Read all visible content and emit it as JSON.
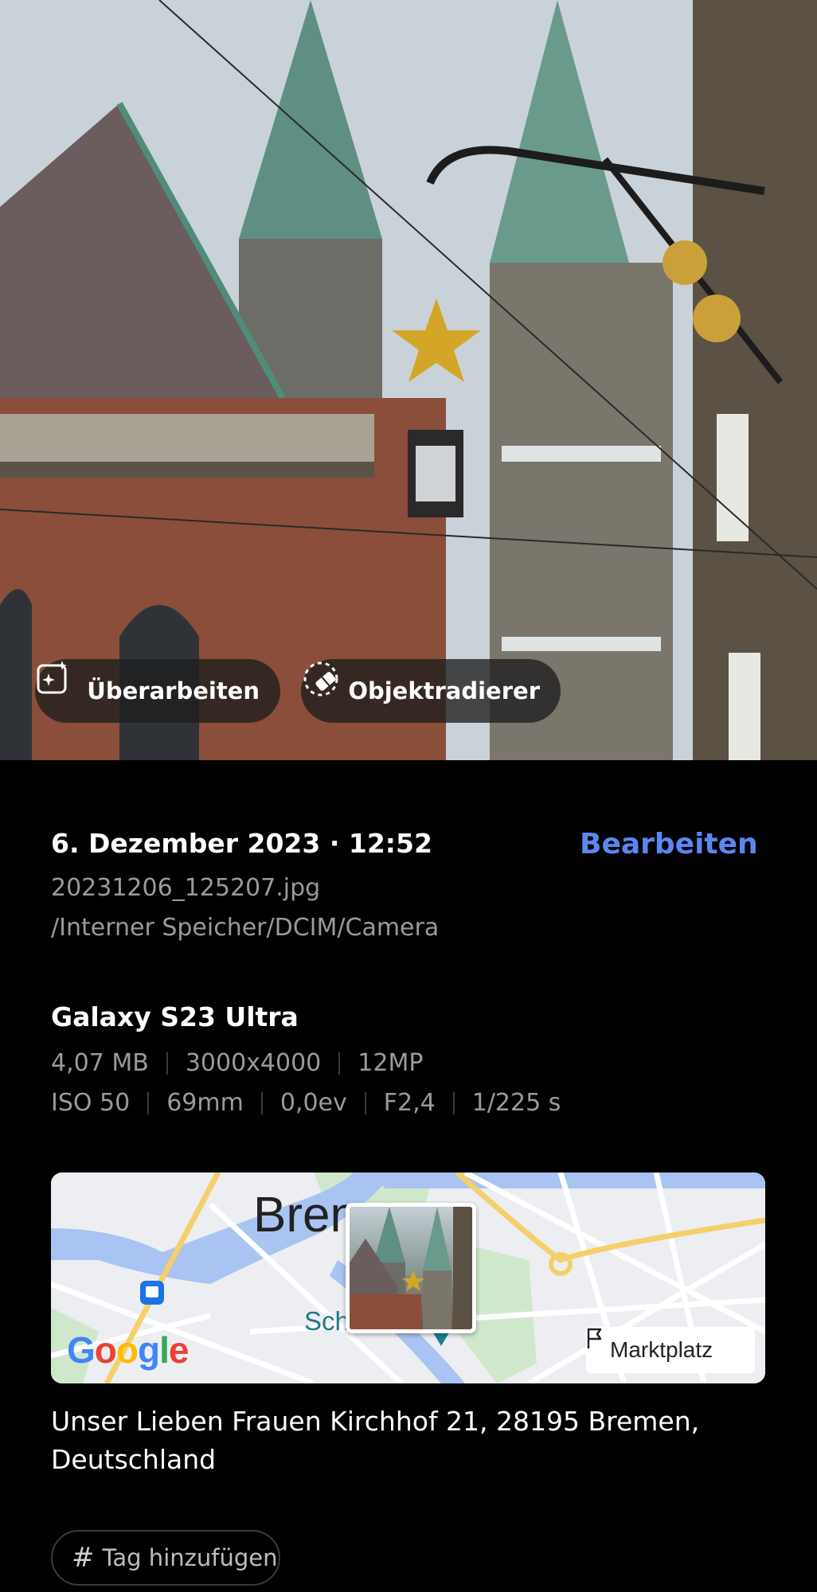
{
  "actions": {
    "enhance_label": "Überarbeiten",
    "eraser_label": "Objektradierer"
  },
  "info": {
    "datetime": "6. Dezember 2023 · 12:52",
    "edit_label": "Bearbeiten",
    "filename": "20231206_125207.jpg",
    "path": "/Interner Speicher/DCIM/Camera"
  },
  "camera": {
    "device": "Galaxy S23 Ultra",
    "size": "4,07 MB",
    "resolution": "3000x4000",
    "megapixels": "12MP",
    "iso": "ISO 50",
    "focal_length": "69mm",
    "exposure": "0,0ev",
    "aperture": "F2,4",
    "shutter": "1/225 s"
  },
  "map": {
    "city_label": "Brem",
    "district_label": "Schno",
    "provider": "Google",
    "place_chip": "Marktplatz"
  },
  "location": {
    "address": "Unser Lieben Frauen Kirchhof 21, 28195 Bremen, Deutschland"
  },
  "tag": {
    "hash": "#",
    "label": "Tag hinzufügen"
  },
  "colors": {
    "accent": "#5b87f2",
    "secondary_text": "#9a9a9a",
    "background": "#000000"
  }
}
